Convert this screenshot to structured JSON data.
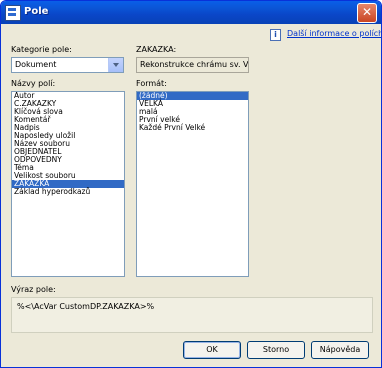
{
  "window": {
    "title": "Pole",
    "close_symbol": "✕"
  },
  "help_link": {
    "text": "Další informace o polích"
  },
  "category": {
    "label": "Kategorie pole:",
    "value": "Dokument"
  },
  "field_value": {
    "label": "ZAKAZKA:",
    "value": "Rekonstrukce chrámu sv. Vít..."
  },
  "field_names": {
    "label": "Názvy polí:",
    "items": [
      "Autor",
      "C.ZAKAZKY",
      "Klíčová slova",
      "Komentář",
      "Nadpis",
      "Naposledy uložil",
      "Název souboru",
      "OBJEDNATEL",
      "ODPOVEDNY",
      "Téma",
      "Velikost souboru",
      "ZAKAZKA",
      "Základ hyperodkazů"
    ],
    "selected": "ZAKAZKA"
  },
  "format": {
    "label": "Formát:",
    "items": [
      "(žádné)",
      "VELKÁ",
      "malá",
      "První velké",
      "Každé První Velké"
    ],
    "selected": "(žádné)"
  },
  "expression": {
    "label": "Výraz pole:",
    "value": "%<\\AcVar CustomDP.ZAKAZKA>%"
  },
  "buttons": {
    "ok": "OK",
    "cancel": "Storno",
    "help": "Nápověda"
  }
}
